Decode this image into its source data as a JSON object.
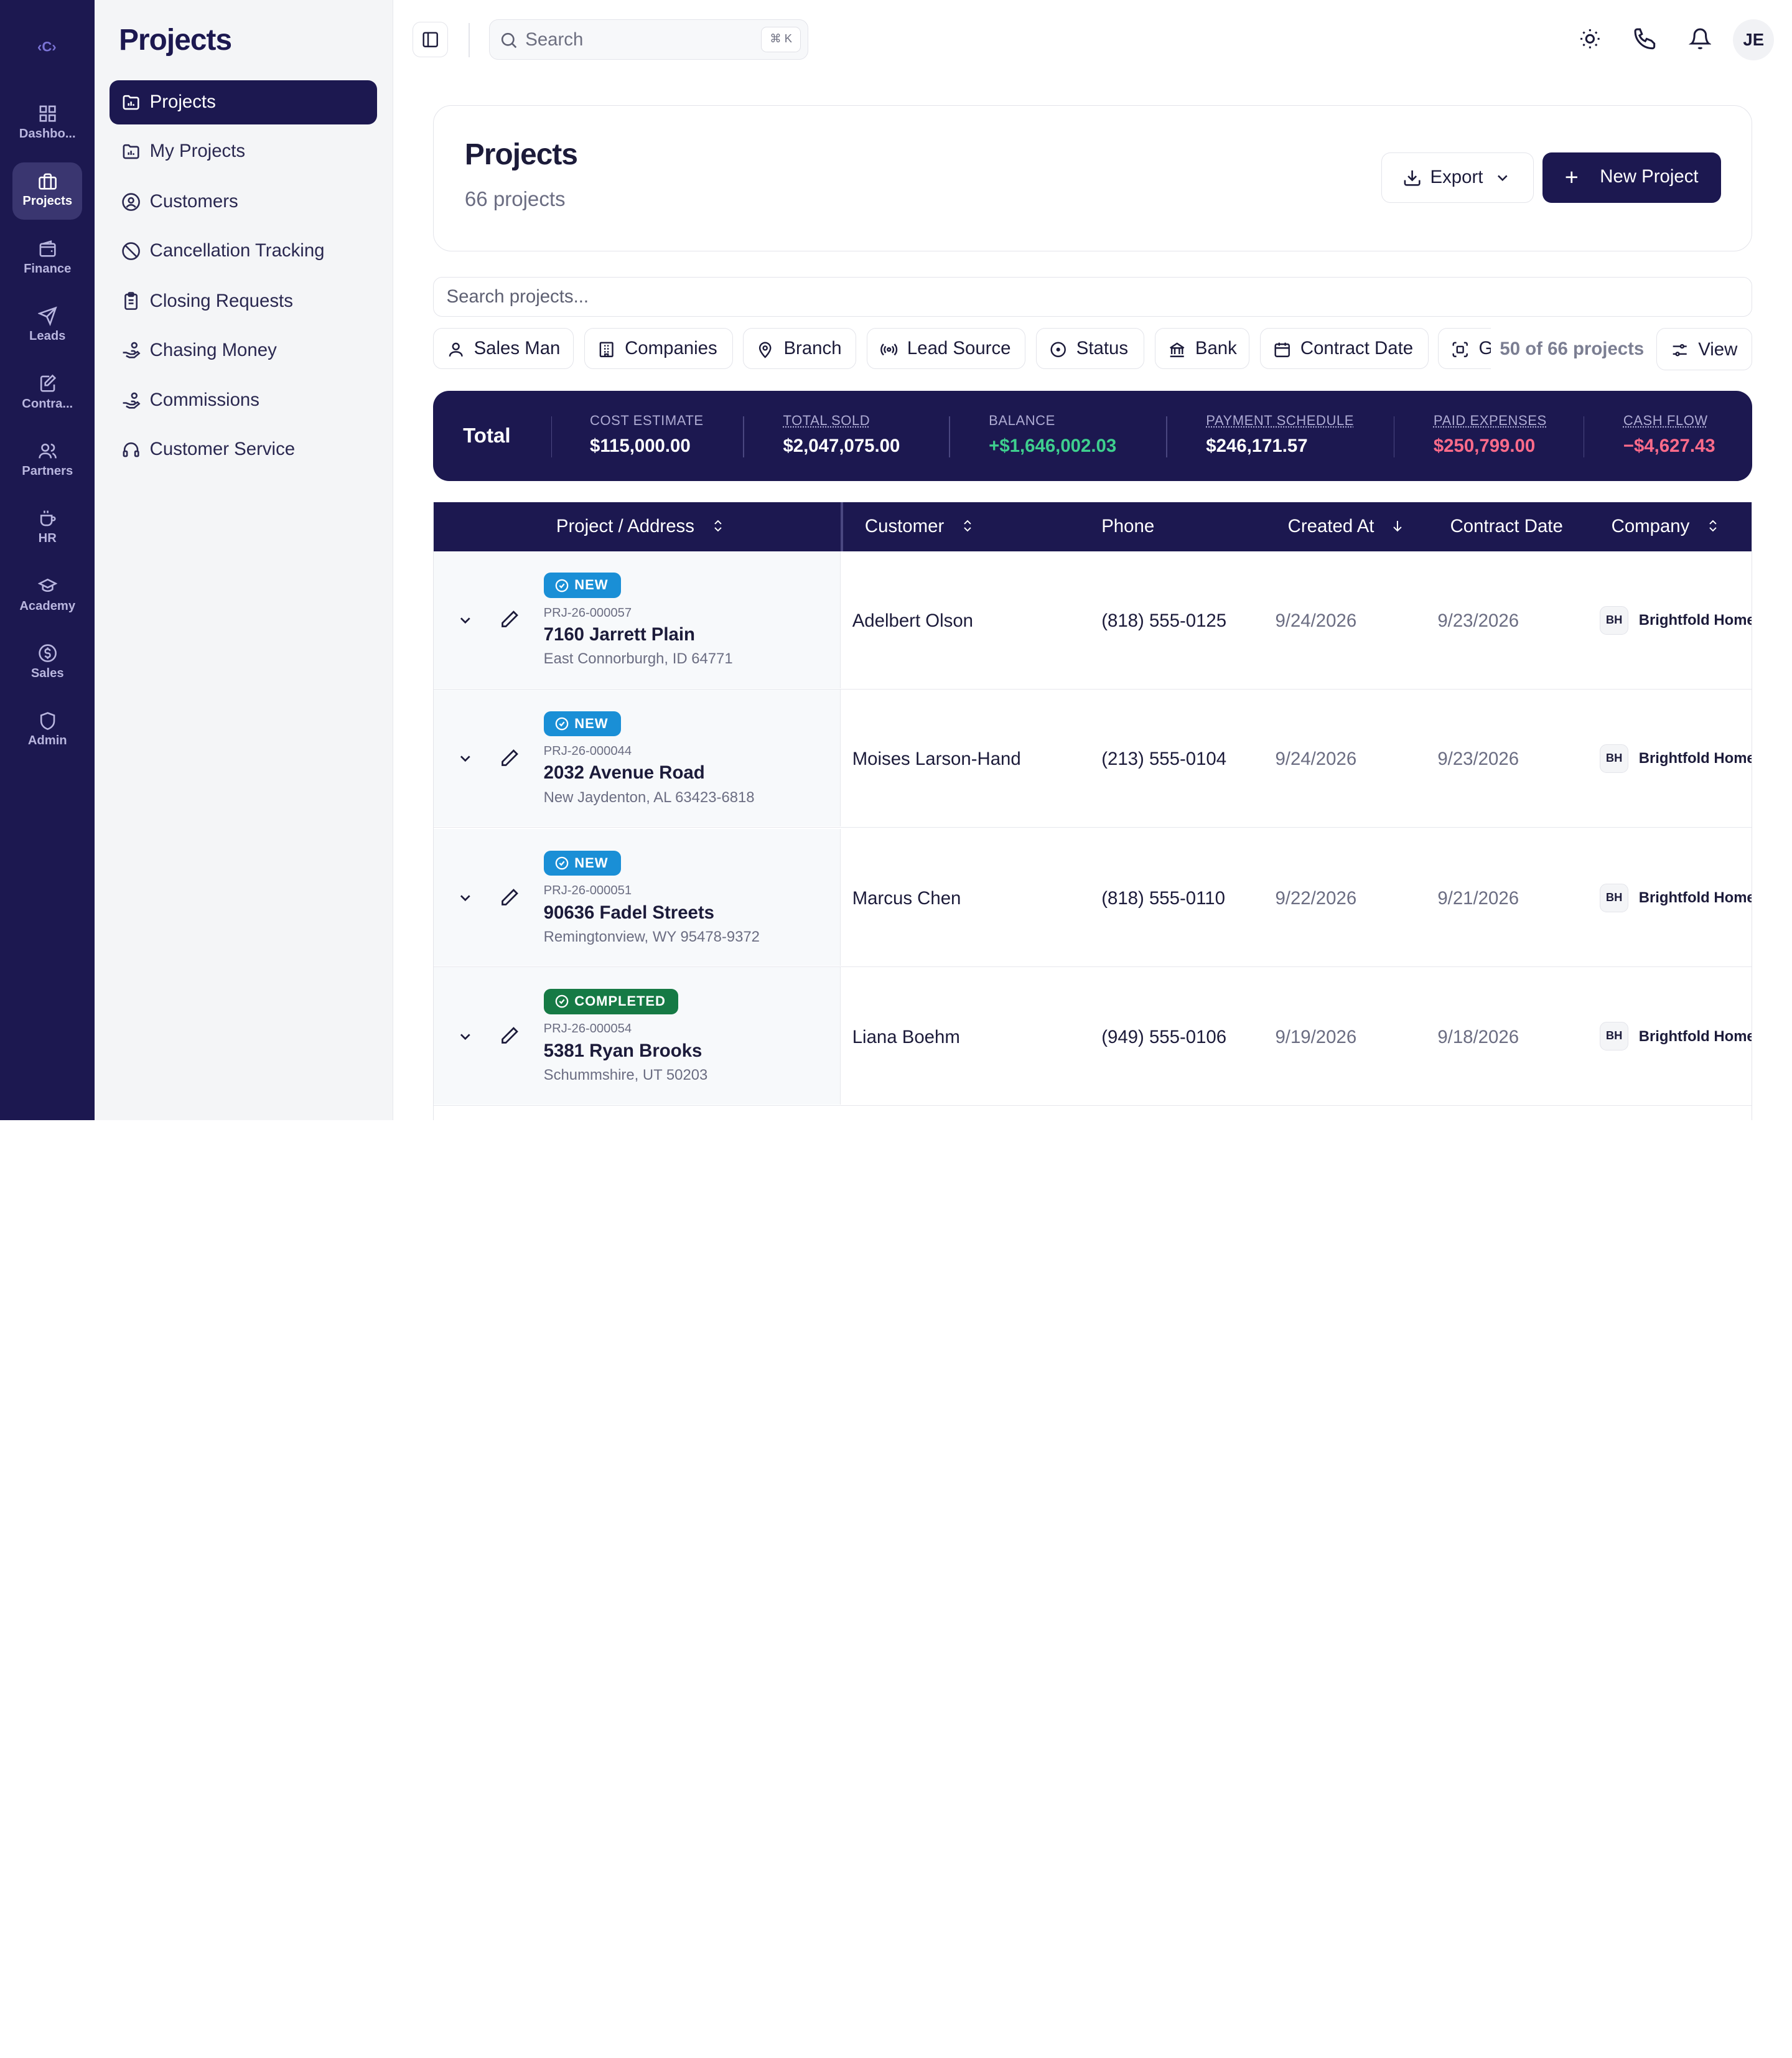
{
  "rail": {
    "logo": "C",
    "items": [
      {
        "label": "Dashbo...",
        "icon": "grid-icon"
      },
      {
        "label": "Projects",
        "icon": "briefcase-icon",
        "active": true
      },
      {
        "label": "Finance",
        "icon": "wallet-icon"
      },
      {
        "label": "Leads",
        "icon": "send-icon"
      },
      {
        "label": "Contra...",
        "icon": "file-edit-icon"
      },
      {
        "label": "Partners",
        "icon": "users-icon"
      },
      {
        "label": "HR",
        "icon": "coffee-icon"
      },
      {
        "label": "Academy",
        "icon": "graduation-cap-icon"
      },
      {
        "label": "Sales",
        "icon": "dollar-circle-icon"
      },
      {
        "label": "Admin",
        "icon": "shield-icon"
      }
    ]
  },
  "sidebar": {
    "title": "Projects",
    "items": [
      {
        "label": "Projects",
        "icon": "folder-chart-icon",
        "active": true
      },
      {
        "label": "My Projects",
        "icon": "folder-chart-icon"
      },
      {
        "label": "Customers",
        "icon": "user-circle-icon"
      },
      {
        "label": "Cancellation Tracking",
        "icon": "ban-icon"
      },
      {
        "label": "Closing Requests",
        "icon": "clipboard-icon"
      },
      {
        "label": "Chasing Money",
        "icon": "hand-coins-icon"
      },
      {
        "label": "Commissions",
        "icon": "hand-coins-icon"
      },
      {
        "label": "Customer Service",
        "icon": "headset-icon"
      }
    ]
  },
  "topbar": {
    "search_placeholder": "Search",
    "shortcut": "⌘ K",
    "avatar_initials": "JE"
  },
  "header": {
    "title": "Projects",
    "subtitle": "66 projects",
    "export_label": "Export",
    "new_label": "New Project"
  },
  "project_search": {
    "placeholder": "Search projects..."
  },
  "filters": [
    "Sales Man",
    "Companies",
    "Branch",
    "Lead Source",
    "Status",
    "Bank",
    "Contract Date",
    "G"
  ],
  "result_count": "50 of 66 projects",
  "view_label": "View",
  "totals": {
    "label": "Total",
    "metrics": [
      {
        "label": "COST ESTIMATE",
        "value": "$115,000.00",
        "color": "#ffffff",
        "underline": false
      },
      {
        "label": "TOTAL SOLD",
        "value": "$2,047,075.00",
        "color": "#ffffff",
        "underline": true
      },
      {
        "label": "BALANCE",
        "value": "+$1,646,002.03",
        "color": "#3ecf8e",
        "underline": false
      },
      {
        "label": "PAYMENT SCHEDULE",
        "value": "$246,171.57",
        "color": "#ffffff",
        "underline": true
      },
      {
        "label": "PAID EXPENSES",
        "value": "$250,799.00",
        "color": "#ff6b8a",
        "underline": true
      },
      {
        "label": "CASH FLOW",
        "value": "−$4,627.43",
        "color": "#ff6b8a",
        "underline": true
      }
    ]
  },
  "table": {
    "columns": [
      "Project / Address",
      "Customer",
      "Phone",
      "Created At",
      "Contract Date",
      "Company"
    ],
    "rows": [
      {
        "status": "NEW",
        "status_type": "new",
        "id": "PRJ-26-000057",
        "address": "7160 Jarrett Plain",
        "city": "East Connorburgh, ID 64771",
        "customer": "Adelbert Olson",
        "phone": "(818) 555-0125",
        "created": "9/24/2026",
        "contract": "9/23/2026",
        "company_initials": "BH",
        "company": "Brightfold Home"
      },
      {
        "status": "NEW",
        "status_type": "new",
        "id": "PRJ-26-000044",
        "address": "2032 Avenue Road",
        "city": "New Jaydenton, AL 63423-6818",
        "customer": "Moises Larson-Hand",
        "phone": "(213) 555-0104",
        "created": "9/24/2026",
        "contract": "9/23/2026",
        "company_initials": "BH",
        "company": "Brightfold Home"
      },
      {
        "status": "NEW",
        "status_type": "new",
        "id": "PRJ-26-000051",
        "address": "90636 Fadel Streets",
        "city": "Remingtonview, WY 95478-9372",
        "customer": "Marcus Chen",
        "phone": "(818) 555-0110",
        "created": "9/22/2026",
        "contract": "9/21/2026",
        "company_initials": "BH",
        "company": "Brightfold Home"
      },
      {
        "status": "COMPLETED",
        "status_type": "completed",
        "id": "PRJ-26-000054",
        "address": "5381 Ryan Brooks",
        "city": "Schummshire, UT 50203",
        "customer": "Liana Boehm",
        "phone": "(949) 555-0106",
        "created": "9/19/2026",
        "contract": "9/18/2026",
        "company_initials": "BH",
        "company": "Brightfold Home"
      }
    ]
  }
}
